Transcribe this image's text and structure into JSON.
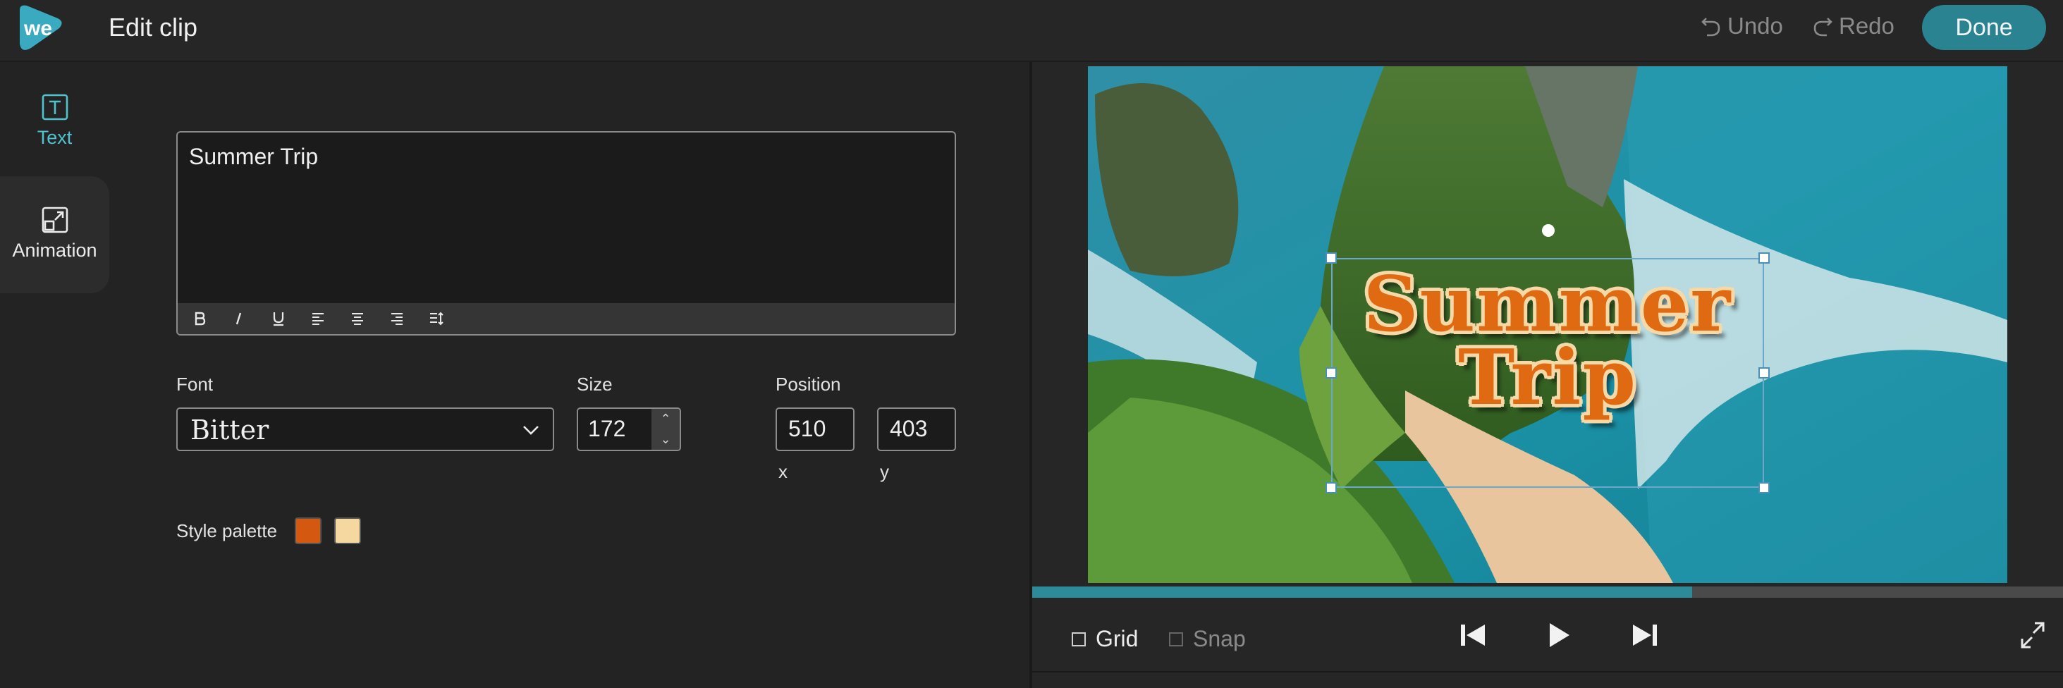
{
  "header": {
    "logo_text": "we",
    "title": "Edit clip",
    "undo_label": "Undo",
    "redo_label": "Redo",
    "done_label": "Done"
  },
  "tabs": [
    {
      "label": "Text",
      "icon": "text-box-icon",
      "active": true
    },
    {
      "label": "Animation",
      "icon": "expand-box-icon",
      "active": false
    }
  ],
  "editor": {
    "text": "Summer Trip",
    "toolbar": [
      "B",
      "I",
      "U",
      "align-left",
      "align-center",
      "align-right",
      "line-spacing"
    ]
  },
  "font": {
    "label": "Font",
    "value": "Bitter"
  },
  "size": {
    "label": "Size",
    "value": "172"
  },
  "position": {
    "label": "Position",
    "x": "510",
    "y": "403",
    "x_label": "x",
    "y_label": "y"
  },
  "style_palette": {
    "label": "Style palette",
    "colors": [
      "#d4580f",
      "#f4d8a0"
    ]
  },
  "preview": {
    "overlay_line1": "Summer",
    "overlay_line2": "Trip",
    "progress": 0.64
  },
  "controls": {
    "grid_label": "Grid",
    "snap_label": "Snap"
  },
  "colors": {
    "accent": "#2a8390",
    "active_tab": "#4fc3cf",
    "overlay_text": "#e06a12",
    "overlay_outline": "#f6d9a6"
  }
}
